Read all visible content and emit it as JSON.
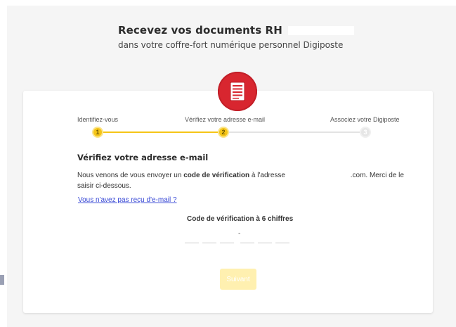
{
  "header": {
    "title": "Recevez vos documents RH",
    "subtitle": "dans votre coffre-fort numérique personnel Digiposte"
  },
  "logo": {
    "icon": "document-icon",
    "color": "#d8262f"
  },
  "stepper": {
    "active_color": "#f5c518",
    "inactive_color": "#e3e3e3",
    "steps": [
      {
        "label": "Identifiez-vous",
        "number": "1",
        "state": "done"
      },
      {
        "label": "Vérifiez votre adresse e-mail",
        "number": "2",
        "state": "current"
      },
      {
        "label": "Associez votre Digiposte",
        "number": "3",
        "state": "pending"
      }
    ]
  },
  "verify": {
    "title": "Vérifiez votre adresse e-mail",
    "text_before": "Nous venons de vous envoyer un ",
    "text_bold": "code de vérification",
    "text_middle": " à l'adresse ",
    "email_suffix": ".com",
    "text_after": ". Merci de le saisir ci-dessous.",
    "resend_link": "Vous n'avez pas reçu d'e-mail ?",
    "code_label": "Code de vérification à 6 chiffres",
    "code_separator": "-",
    "submit_label": "Suivant"
  }
}
